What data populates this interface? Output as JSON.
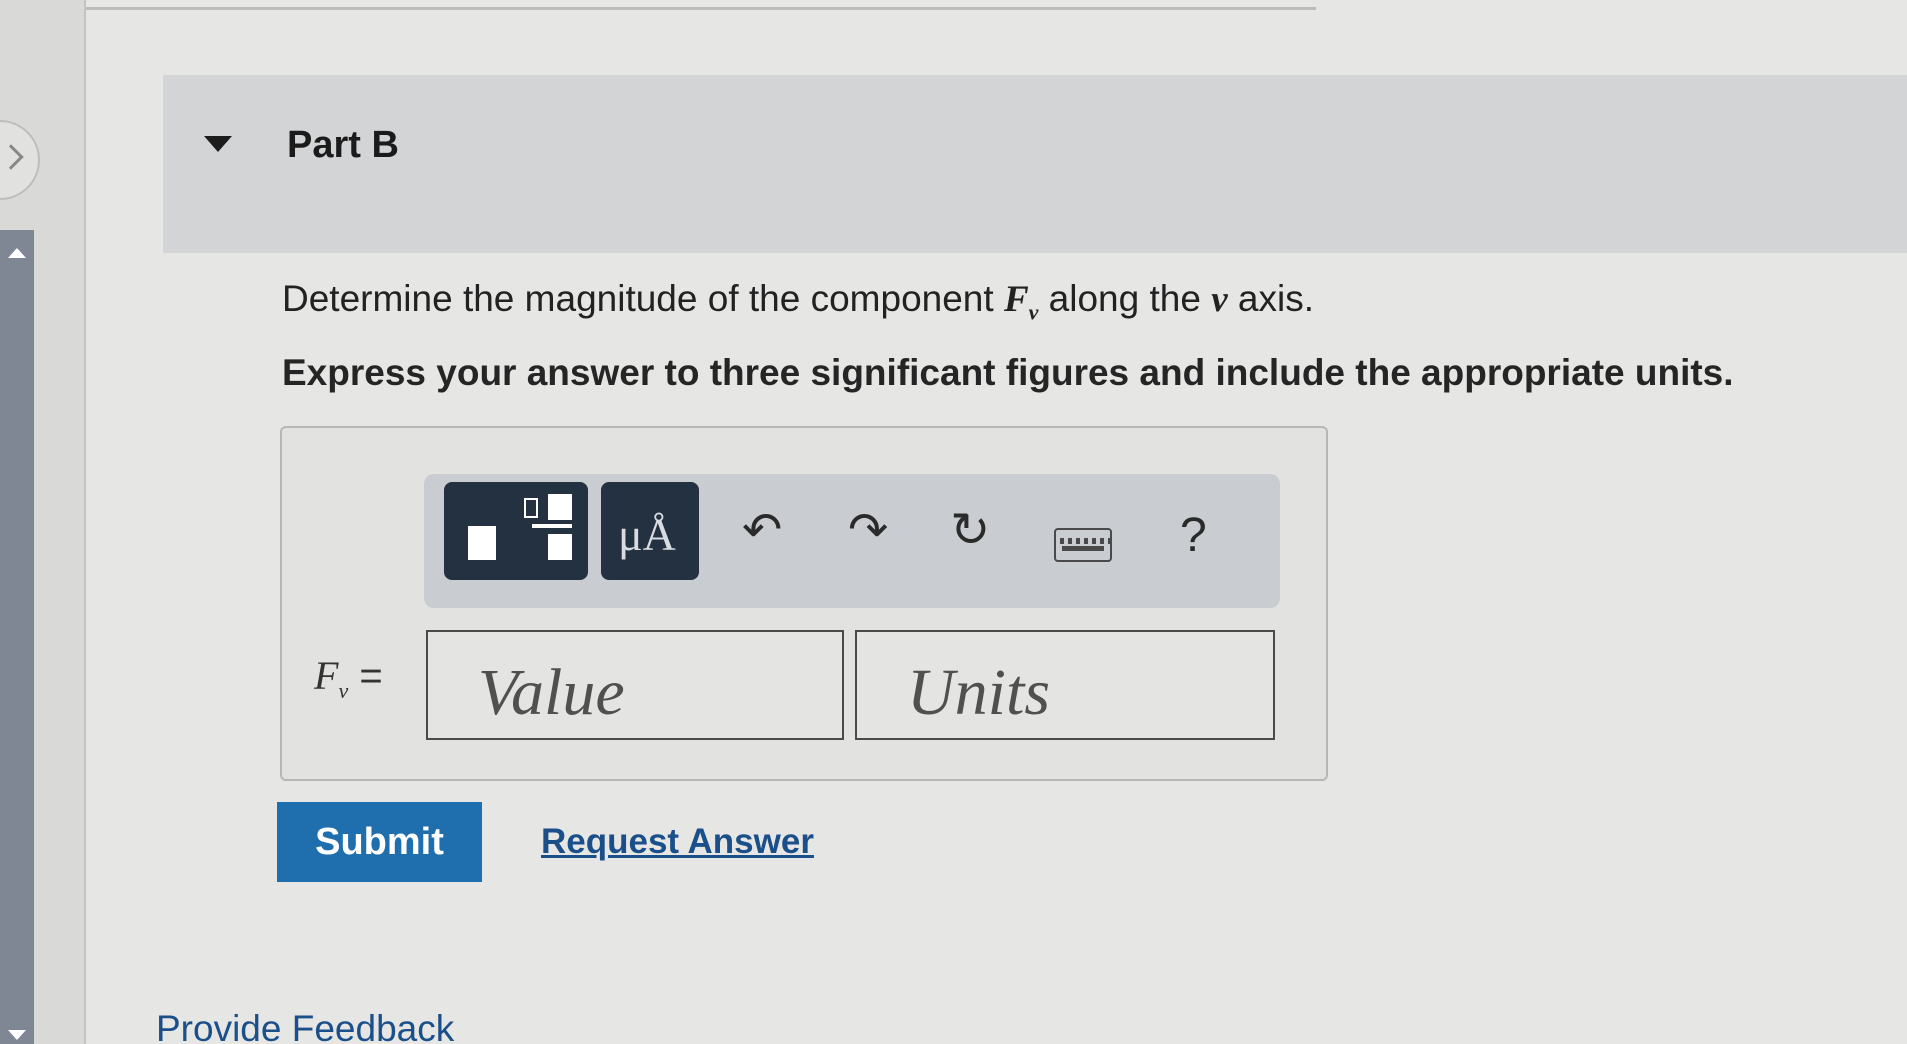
{
  "part": {
    "title": "Part B"
  },
  "question": {
    "prefix": "Determine the magnitude of the component ",
    "symbol": "F",
    "subscript": "v",
    "middle": " along the ",
    "axis_var": "v",
    "suffix": " axis.",
    "instruction": "Express your answer to three significant figures and include the appropriate units."
  },
  "toolbar": {
    "units_label": "μÅ",
    "help_label": "?",
    "icons": [
      "templates-icon",
      "units-icon",
      "undo-icon",
      "redo-icon",
      "reset-icon",
      "keyboard-icon",
      "help-icon"
    ]
  },
  "answer": {
    "var_symbol": "F",
    "var_subscript": "v",
    "equals": "=",
    "value_placeholder": "Value",
    "units_placeholder": "Units"
  },
  "actions": {
    "submit_label": "Submit",
    "request_answer_label": "Request Answer"
  },
  "footer": {
    "feedback_label": "Provide Feedback"
  },
  "colors": {
    "submit_bg": "#1f6fae",
    "toolbar_dark": "#243140",
    "link": "#1b4f8a",
    "header_bg": "#d2d4d6"
  }
}
